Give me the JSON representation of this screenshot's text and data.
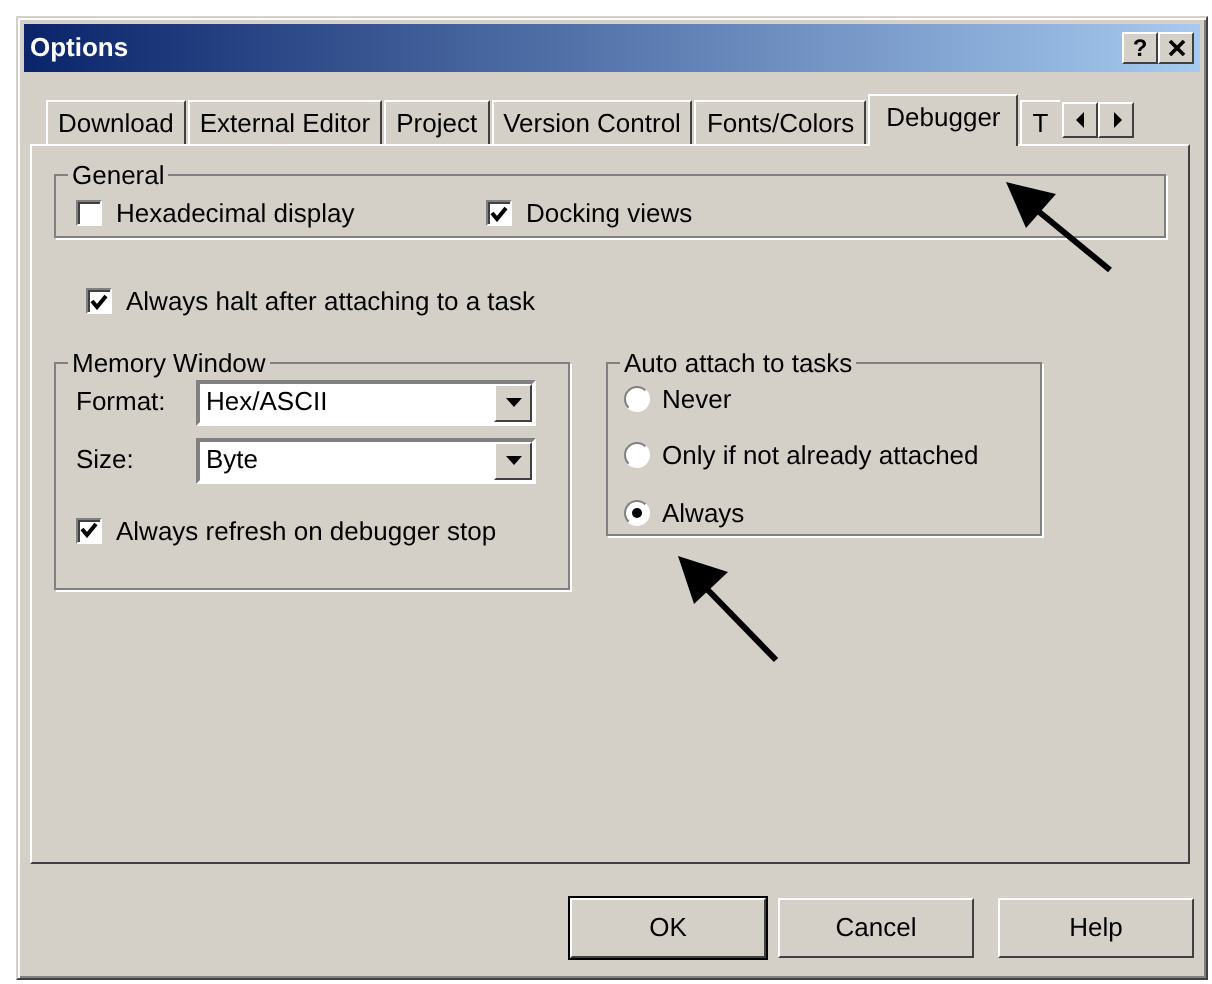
{
  "window": {
    "title": "Options",
    "help_button": "?"
  },
  "tabs": [
    {
      "label": "Download",
      "selected": false
    },
    {
      "label": "External Editor",
      "selected": false
    },
    {
      "label": "Project",
      "selected": false
    },
    {
      "label": "Version Control",
      "selected": false
    },
    {
      "label": "Fonts/Colors",
      "selected": false
    },
    {
      "label": "Debugger",
      "selected": true
    },
    {
      "label": "T",
      "selected": false
    }
  ],
  "general": {
    "title": "General",
    "checkboxes": [
      {
        "label": "Hexadecimal display",
        "checked": false
      },
      {
        "label": "Docking views",
        "checked": true
      }
    ]
  },
  "halt_checkbox": {
    "label": "Always halt after attaching to a task",
    "checked": true
  },
  "memory_window": {
    "title": "Memory Window",
    "fields": [
      {
        "label": "Format:",
        "value": "Hex/ASCII"
      },
      {
        "label": "Size:",
        "value": "Byte"
      }
    ],
    "refresh_checkbox": {
      "label": "Always refresh on debugger stop",
      "checked": true
    }
  },
  "auto_attach": {
    "title": "Auto attach to tasks",
    "options": [
      {
        "label": "Never",
        "selected": false
      },
      {
        "label": "Only if not already attached",
        "selected": false
      },
      {
        "label": "Always",
        "selected": true
      }
    ]
  },
  "buttons": [
    {
      "label": "OK",
      "default": true
    },
    {
      "label": "Cancel",
      "default": false
    },
    {
      "label": "Help",
      "default": false
    }
  ]
}
